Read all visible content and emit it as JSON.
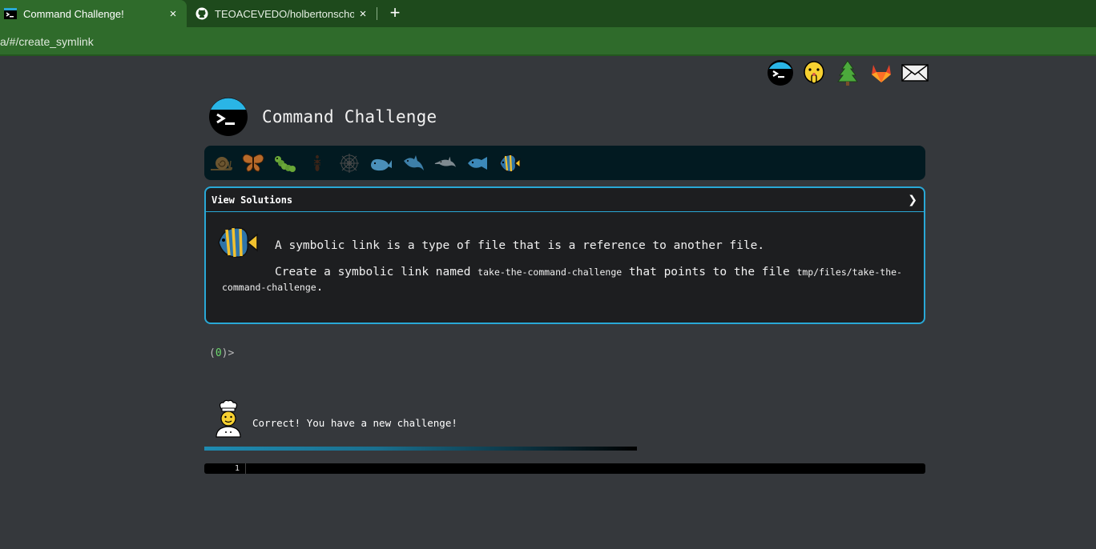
{
  "browser": {
    "tabs": [
      {
        "title": "Command Challenge!",
        "active": true,
        "close": "×"
      },
      {
        "title": "TEOACEVEDO/holbertonschool-s",
        "active": false,
        "close": "×"
      }
    ],
    "new_tab": "+",
    "url": "a/#/create_symlink"
  },
  "header": {
    "title": "Command Challenge",
    "top_icons": [
      "terminal-icon",
      "shushing-face-icon",
      "tree-icon",
      "gitlab-icon",
      "envelope-icon"
    ]
  },
  "levels": [
    "snail-icon",
    "butterfly-icon",
    "caterpillar-icon",
    "ant-icon",
    "spiderweb-icon",
    "whale-icon",
    "shark-icon",
    "dolphin-icon",
    "fish-icon",
    "tropical-fish-icon"
  ],
  "challenge": {
    "view_solutions": "View Solutions",
    "chevron": "❯",
    "line1": "A symbolic link is a type of file that is a reference to another file.",
    "line2_a": "Create a symbolic link named ",
    "line2_code1": "take-the-command-challenge",
    "line2_b": " that points to the file ",
    "line2_code2": "tmp/files/take-the-command-challenge",
    "line2_c": "."
  },
  "prompt": {
    "open": "(",
    "count": "0",
    "close": ")>"
  },
  "feedback": {
    "message": "Correct! You have a new challenge!"
  },
  "progress": {
    "fraction": 1.0
  },
  "editor": {
    "line_number": "1"
  },
  "colors": {
    "accent": "#29a8d6",
    "tab_active": "#2f6b2b",
    "page_bg": "#35383c"
  }
}
